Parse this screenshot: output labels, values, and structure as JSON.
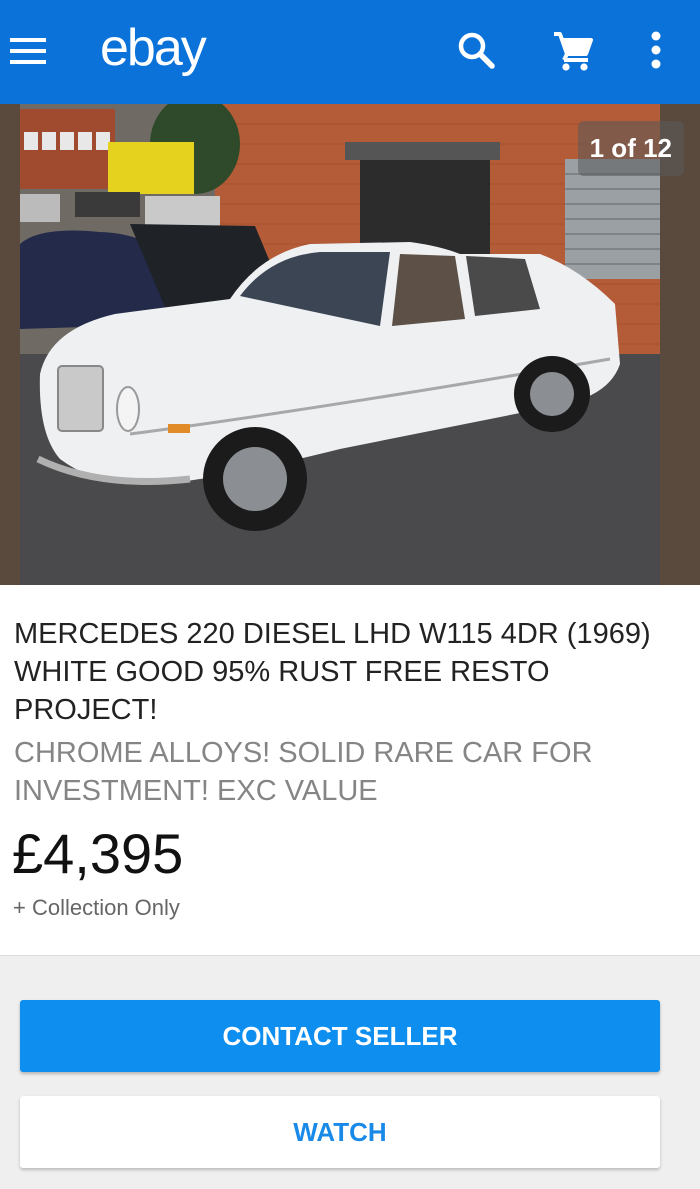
{
  "app": {
    "logo": "ebay",
    "icons": {
      "menu": "menu-icon",
      "search": "search-icon",
      "cart": "cart-icon",
      "more": "more-vert-icon"
    },
    "colors": {
      "appbar": "#0b72d9",
      "primary_button": "#0e8ff0",
      "secondary_text": "#1a8ae8"
    }
  },
  "gallery": {
    "counter": "1 of 12"
  },
  "listing": {
    "title": "MERCEDES 220 DIESEL LHD W115 4DR (1969) WHITE GOOD 95% RUST FREE RESTO PROJECT!",
    "subtitle": "CHROME ALLOYS! SOLID RARE CAR FOR INVESTMENT! EXC VALUE",
    "price": "£4,395",
    "shipping": "+ Collection Only"
  },
  "actions": {
    "contact_label": "CONTACT SELLER",
    "watch_label": "WATCH"
  }
}
